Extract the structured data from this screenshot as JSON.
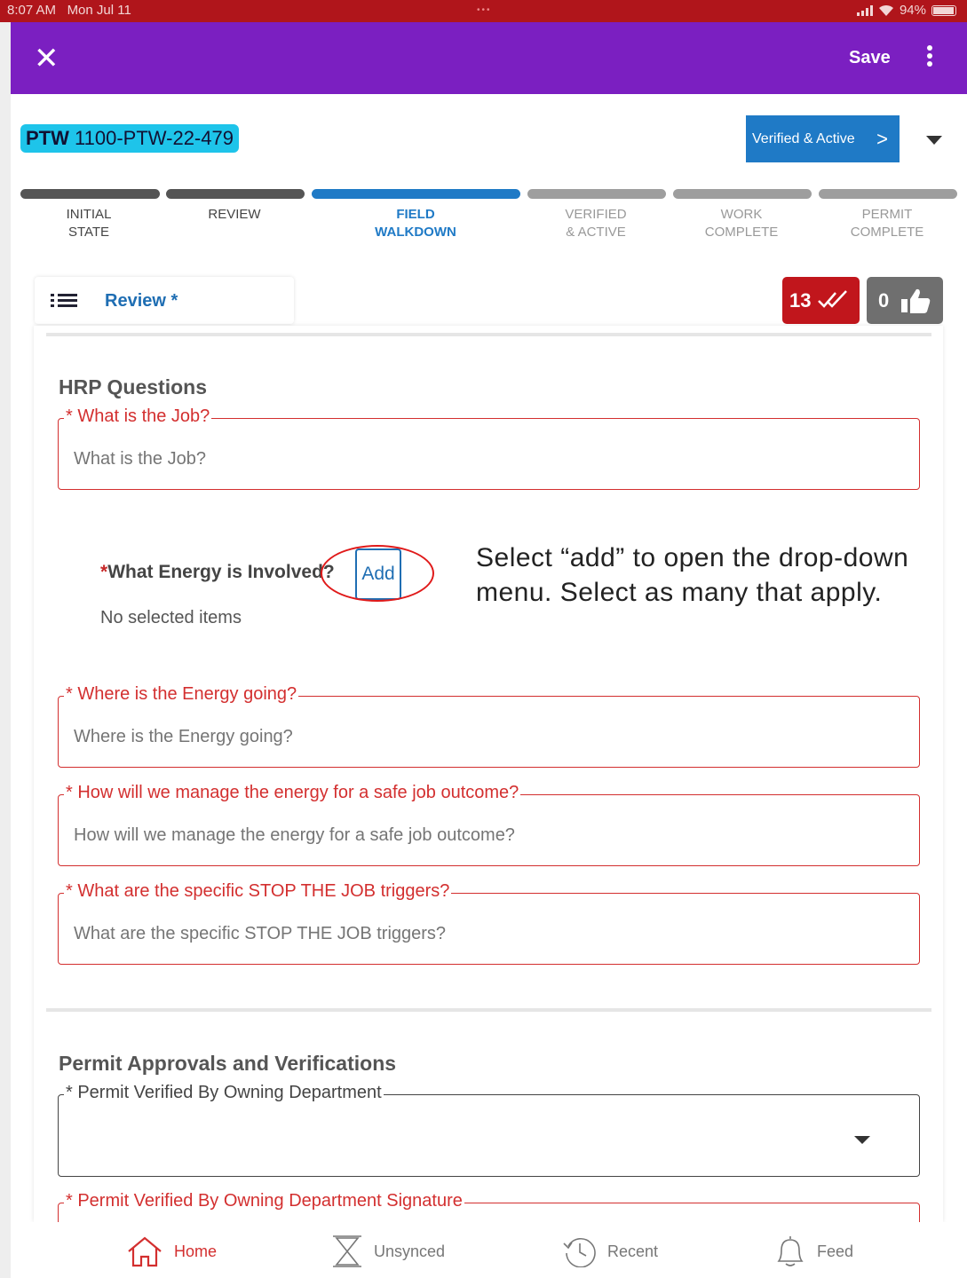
{
  "status_bar": {
    "time": "8:07 AM",
    "date": "Mon Jul 11",
    "battery": "94%"
  },
  "header": {
    "save_label": "Save",
    "close_icon": "close-icon",
    "menu_icon": "kebab-menu-icon",
    "accent_color": "#7b1fc1"
  },
  "permit": {
    "prefix": "PTW",
    "number": "1100-PTW-22-479",
    "state_button": "Verified & Active",
    "state_chevron": ">"
  },
  "stepper": {
    "steps": [
      {
        "line1": "INITIAL",
        "line2": "STATE",
        "status": "done"
      },
      {
        "line1": "REVIEW",
        "line2": "",
        "status": "done"
      },
      {
        "line1": "FIELD",
        "line2": "WALKDOWN",
        "status": "current"
      },
      {
        "line1": "VERIFIED",
        "line2": "& ACTIVE",
        "status": "todo"
      },
      {
        "line1": "WORK",
        "line2": "COMPLETE",
        "status": "todo"
      },
      {
        "line1": "PERMIT",
        "line2": "COMPLETE",
        "status": "todo"
      }
    ],
    "colors": {
      "done": "#555555",
      "current": "#1f7ac6",
      "todo": "#9e9e9e"
    }
  },
  "review_tab": {
    "label": "Review *"
  },
  "badges": {
    "checks_count": "13",
    "likes_count": "0",
    "checks_color": "#c1161c",
    "likes_color": "#6f6f6f"
  },
  "hrp": {
    "title": "HRP Questions",
    "job_label": "* What is the Job?",
    "job_placeholder": "What is the Job?",
    "energy_label_star": "*",
    "energy_label": "What Energy is Involved?",
    "add_label": "Add",
    "no_items": "No selected items",
    "where_label": "* Where is the Energy going?",
    "where_placeholder": "Where is the Energy going?",
    "manage_label": "* How will we manage the energy for a safe job outcome?",
    "manage_placeholder": "How will we manage the energy for a safe job outcome?",
    "stop_label": "* What are the specific STOP THE JOB triggers?",
    "stop_placeholder": "What are the specific STOP THE JOB triggers?"
  },
  "annotation": {
    "text": "Select “add” to open the drop-down menu.  Select as many that apply."
  },
  "approvals": {
    "title": "Permit Approvals and Verifications",
    "verified_label": "* Permit Verified By Owning Department",
    "signature_label": "* Permit Verified By Owning Department Signature"
  },
  "bottom_nav": {
    "items": [
      {
        "label": "Home",
        "icon": "home-icon"
      },
      {
        "label": "Unsynced",
        "icon": "hourglass-icon"
      },
      {
        "label": "Recent",
        "icon": "history-icon"
      },
      {
        "label": "Feed",
        "icon": "bell-icon"
      }
    ]
  }
}
